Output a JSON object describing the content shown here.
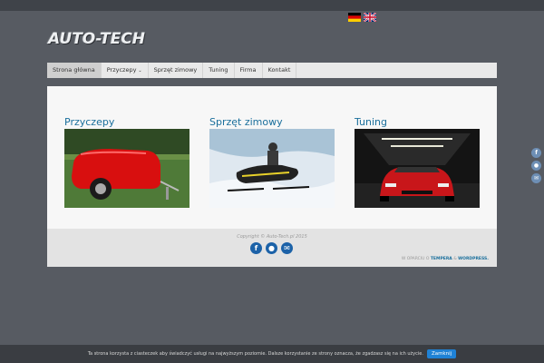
{
  "header": {
    "logo_text": "AUTO-TECH",
    "languages": [
      {
        "icon": "flag-de-icon"
      },
      {
        "icon": "flag-gb-icon"
      }
    ]
  },
  "nav": {
    "items": [
      {
        "label": "Strona główna",
        "active": true
      },
      {
        "label": "Przyczepy",
        "has_dropdown": true
      },
      {
        "label": "Sprzęt zimowy"
      },
      {
        "label": "Tuning"
      },
      {
        "label": "Firma"
      },
      {
        "label": "Kontakt"
      }
    ]
  },
  "main": {
    "sections": [
      {
        "title": "Przyczepy",
        "image": "red-trailer-image"
      },
      {
        "title": "Sprzęt zimowy",
        "image": "snowmobile-image"
      },
      {
        "title": "Tuning",
        "image": "red-car-garage-image"
      }
    ]
  },
  "footer": {
    "copyright": "Copyright © Auto-Tech.pl 2015",
    "social_icons": [
      "facebook-icon",
      "user-icon",
      "email-icon"
    ],
    "powered_prefix": "W OPARCIU O",
    "powered_theme": "TEMPERA",
    "powered_and": "&",
    "powered_cms": "WORDPRESS."
  },
  "cookie": {
    "text": "Ta strona korzysta z ciasteczek aby świadczyć usługi na najwyższym poziomie. Dalsze korzystanie ze strony oznacza, że zgadzasz się na ich użycie.",
    "button": "Zamknij"
  },
  "colors": {
    "background": "#575b62",
    "accent": "#1a6f9c",
    "social": "#1c62a8",
    "cookie_button": "#1f82d6"
  }
}
